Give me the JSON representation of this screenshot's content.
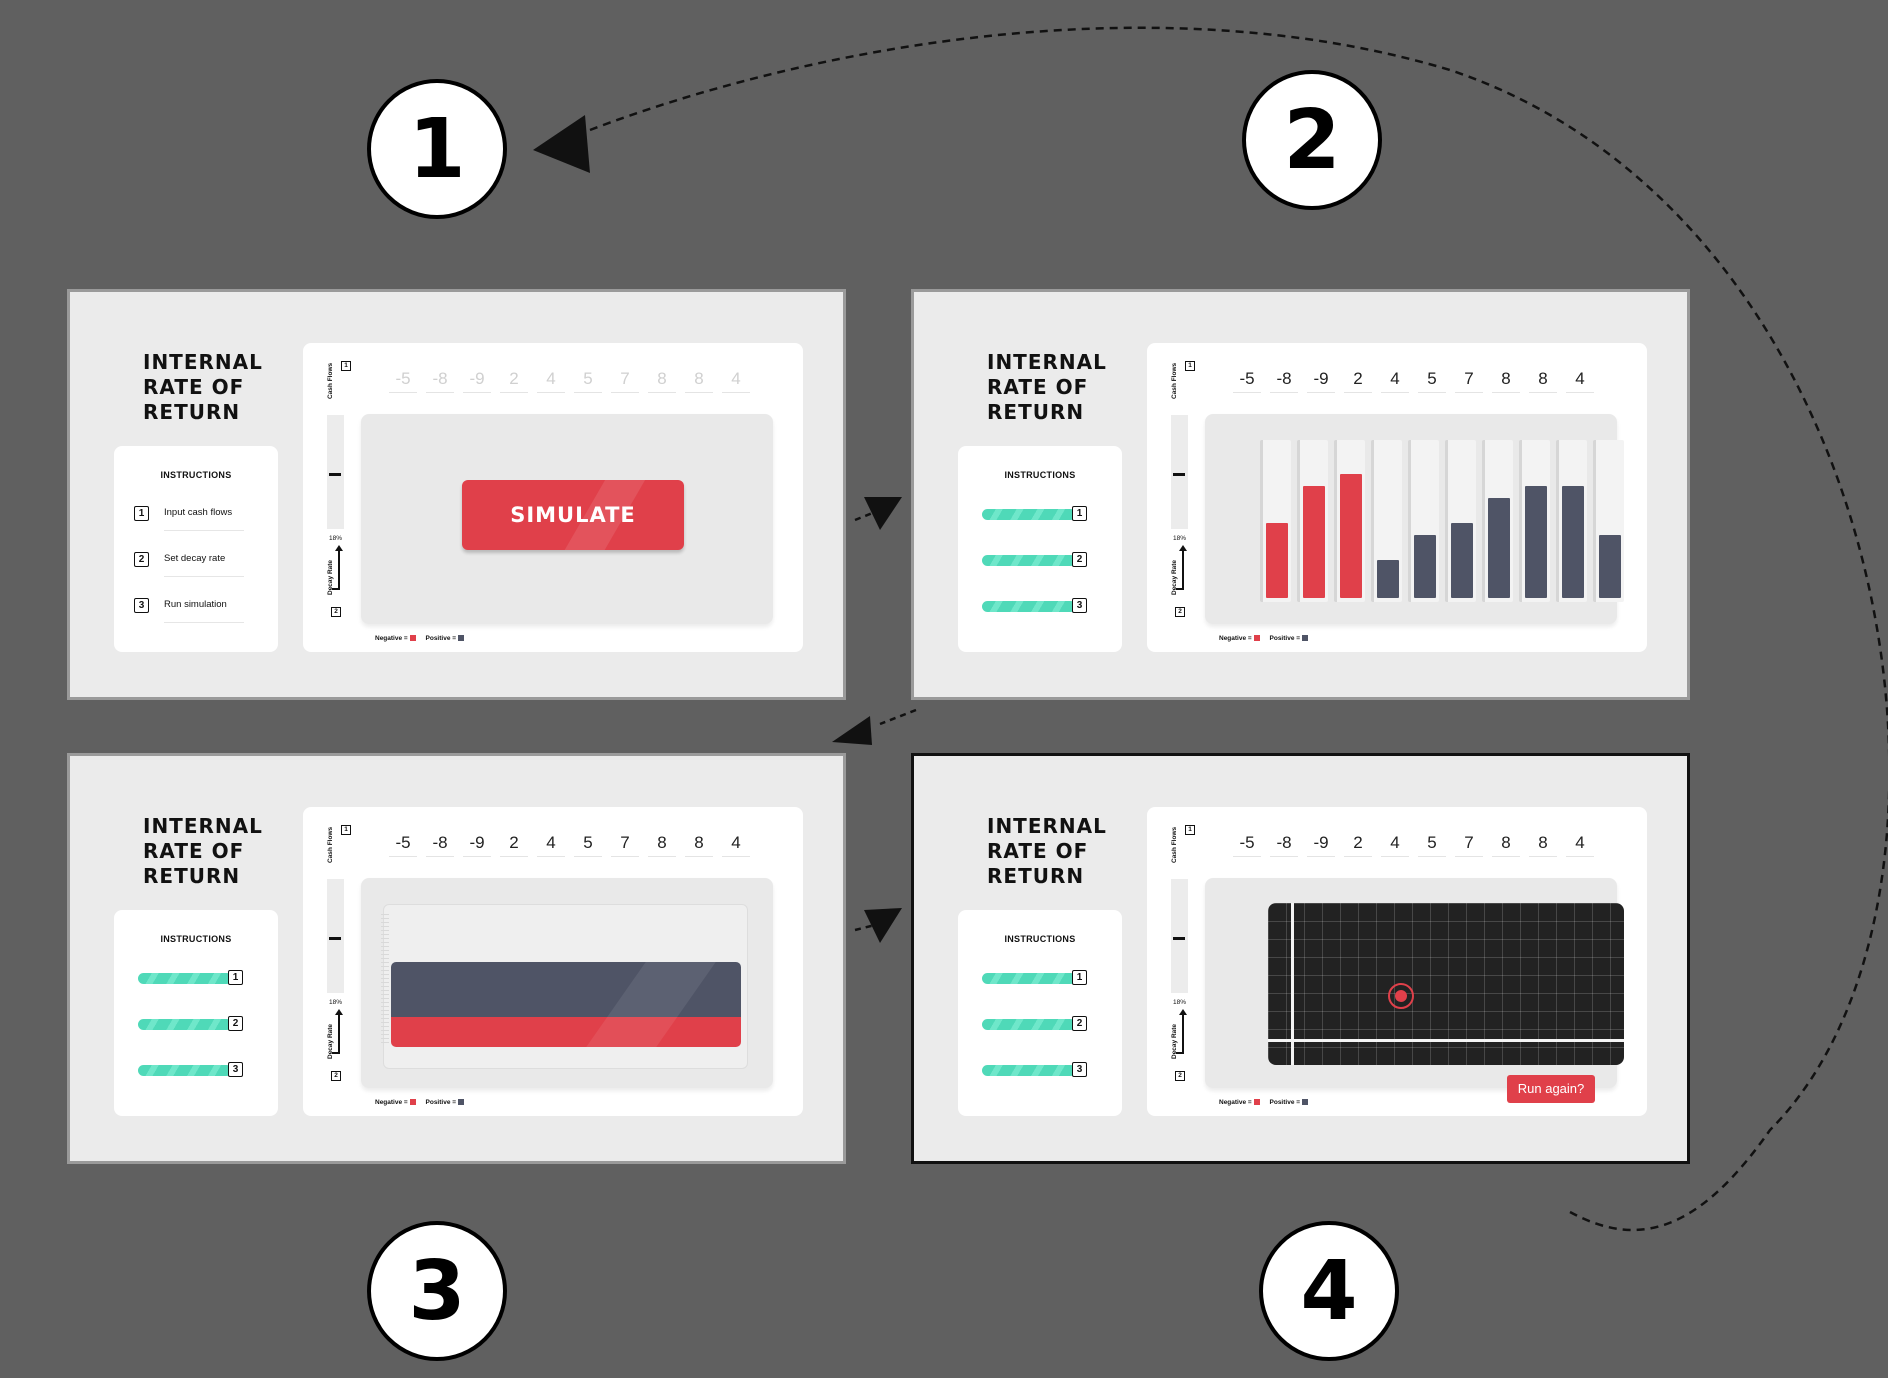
{
  "steps": [
    "1",
    "2",
    "3",
    "4"
  ],
  "app_title": "INTERNAL RATE OF RETURN",
  "instructions": {
    "heading": "INSTRUCTIONS",
    "items": [
      {
        "number": "1",
        "label": "Input cash flows"
      },
      {
        "number": "2",
        "label": "Set decay rate"
      },
      {
        "number": "3",
        "label": "Run simulation"
      }
    ]
  },
  "side_labels": {
    "cash_flows": "Cash Flows",
    "cash_flows_num": "1",
    "decay_rate": "Decay Rate",
    "decay_rate_num": "2",
    "decay_value": "18%"
  },
  "cash_flows": [
    -5,
    -8,
    -9,
    2,
    4,
    5,
    7,
    8,
    8,
    4
  ],
  "legend": {
    "negative": "Negative =",
    "positive": "Positive =",
    "negative_color": "#e0404a",
    "positive_color": "#4f5466"
  },
  "buttons": {
    "simulate": "SIMULATE",
    "run_again": "Run again?"
  },
  "colors": {
    "accent": "#e0404a",
    "dark": "#4f5466",
    "progress": "#4fd9b8"
  }
}
